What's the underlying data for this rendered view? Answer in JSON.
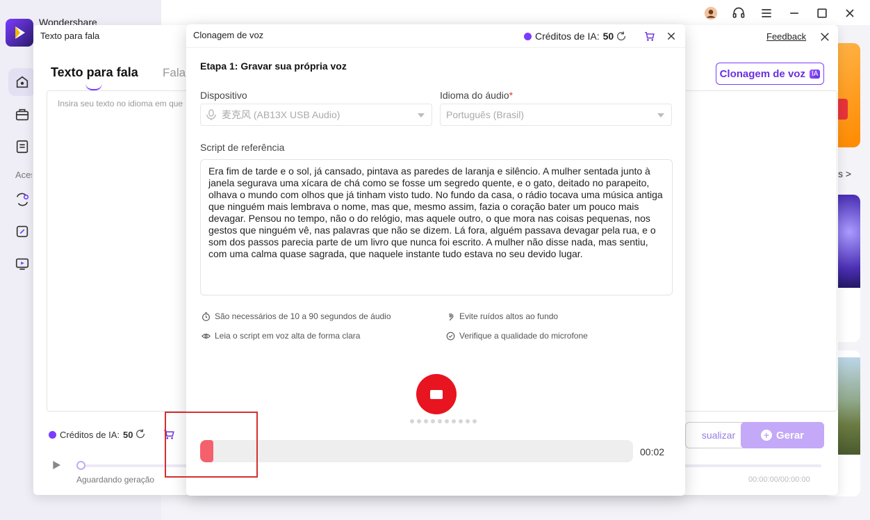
{
  "app": {
    "name": "Wondershare"
  },
  "sidebar": {
    "section_label": "Acessórios",
    "icons": [
      "home-icon",
      "toolbox-icon",
      "document-icon",
      "convert-icon",
      "edit-icon",
      "media-icon"
    ]
  },
  "topbar": {
    "icons": [
      "avatar-icon",
      "headset-icon",
      "menu-icon",
      "minimize-icon",
      "maximize-icon",
      "close-icon"
    ]
  },
  "right_panel": {
    "more_label": "s >"
  },
  "tts": {
    "window_title": "Texto para fala",
    "feedback_label": "Feedback",
    "tab_active": "Texto para fala",
    "tab_second": "Fala",
    "clone_button": "Clonagem de voz",
    "ia_badge": "IA",
    "placeholder": "Insira seu texto no idioma em que",
    "credits_label": "Créditos de IA:",
    "credits_value": "50",
    "visualize_label": "sualizar",
    "generate_label": "Gerar",
    "status": "Aguardando geração",
    "time": "00:00:00/00:00:00"
  },
  "voice_clone": {
    "title": "Clonagem de voz",
    "credits_label": "Créditos de IA:",
    "credits_value": "50",
    "step_title": "Etapa 1: Gravar sua própria voz",
    "device_label": "Dispositivo",
    "device_value": "麦克风 (AB13X USB Audio)",
    "language_label": "Idioma do áudio",
    "required_mark": "*",
    "language_value": "Português (Brasil)",
    "script_label": "Script de referência",
    "script_text": "Era fim de tarde e o sol, já cansado, pintava as paredes de laranja e silêncio. A mulher sentada junto à janela segurava uma xícara de chá como se fosse um segredo quente, e o gato, deitado no parapeito, olhava o mundo com olhos que já tinham visto tudo. No fundo da casa, o rádio tocava uma música antiga que ninguém mais lembrava o nome, mas que, mesmo assim, fazia o coração bater um pouco mais devagar. Pensou no tempo, não o do relógio, mas aquele outro, o que mora nas coisas pequenas, nos gestos que ninguém vê, nas palavras que não se dizem. Lá fora, alguém passava devagar pela rua, e o som dos passos parecia parte de um livro que nunca foi escrito. A mulher não disse nada, mas sentiu, com uma calma quase sagrada, que naquele instante tudo estava no seu devido lugar.",
    "tips": {
      "duration": "São necessários de 10 a 90 segundos de áudio",
      "noise": "Evite ruídos altos ao fundo",
      "read": "Leia o script em voz alta de forma clara",
      "mic": "Verifique a qualidade do microfone"
    },
    "recording_progress": 0.03,
    "elapsed": "00:02"
  },
  "colors": {
    "accent": "#7a3cff",
    "record": "#e8141f",
    "progress_fill": "#f4616c",
    "highlight": "#d32f2f"
  }
}
